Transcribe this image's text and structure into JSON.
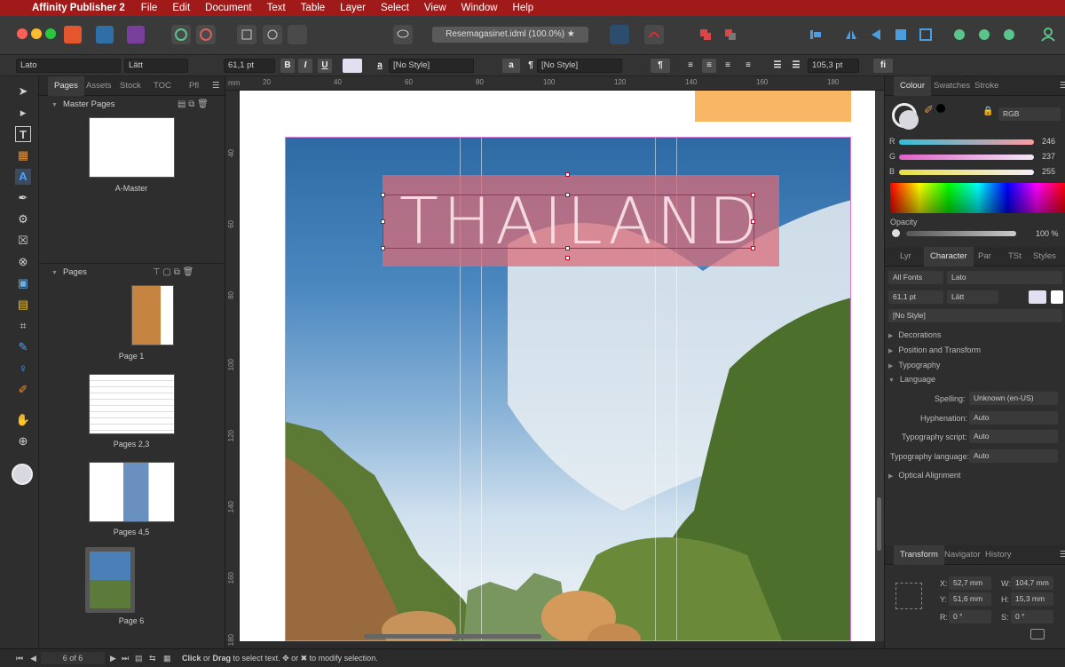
{
  "menubar": {
    "app_name": "Affinity Publisher 2",
    "items": [
      "File",
      "Edit",
      "Document",
      "Text",
      "Table",
      "Layer",
      "Select",
      "View",
      "Window",
      "Help"
    ]
  },
  "toolbar": {
    "document_title": "Resemagasinet.idml (100.0%)"
  },
  "context": {
    "font": "Lato",
    "weight": "Lätt",
    "size": "61,1 pt",
    "bold": "B",
    "italic": "I",
    "underline": "U",
    "char_style": "[No Style]",
    "para_style": "[No Style]",
    "leading": "105,3 pt",
    "fi": "fi",
    "a1": "a",
    "a2": "a",
    "pilcrow": "¶"
  },
  "leftpanel": {
    "tabs": [
      "Pages",
      "Assets",
      "Stock",
      "TOC",
      "Pfl"
    ],
    "master_pages_label": "Master Pages",
    "master_caption": "A-Master",
    "pages_label": "Pages",
    "pages": [
      "Page 1",
      "Pages 2,3",
      "Pages 4,5",
      "Page 6"
    ]
  },
  "ruler": {
    "unit": "mm",
    "top": [
      "20",
      "40",
      "60",
      "80",
      "100",
      "120",
      "140",
      "160",
      "180"
    ],
    "left": [
      "40",
      "60",
      "80",
      "100",
      "120",
      "140",
      "160",
      "180"
    ]
  },
  "canvas": {
    "headline": "THAILAND"
  },
  "status": {
    "page_counter": "6 of 6",
    "hint_click": "Click",
    "hint_or": " or ",
    "hint_drag": "Drag",
    "hint_rest": " to select text. ✥ or ✖ to modify selection."
  },
  "rightpanel": {
    "top_tabs": [
      "Colour",
      "Swatches",
      "Stroke"
    ],
    "color_model": "RGB",
    "r": "246",
    "g": "237",
    "b": "255",
    "opacity_label": "Opacity",
    "opacity_value": "100 %",
    "char_tabs": [
      "Lyr",
      "Character",
      "Par",
      "TSt",
      "Styles"
    ],
    "all_fonts": "All Fonts",
    "font": "Lato",
    "size": "61,1 pt",
    "weight": "Lätt",
    "style": "[No Style]",
    "sections": [
      "Decorations",
      "Position and Transform",
      "Typography",
      "Language"
    ],
    "spelling_label": "Spelling:",
    "spelling_value": "Unknown (en-US)",
    "hyphenation_label": "Hyphenation:",
    "hyphenation_value": "Auto",
    "script_label": "Typography script:",
    "script_value": "Auto",
    "language_label": "Typography language:",
    "language_value": "Auto",
    "optical": "Optical Alignment",
    "transform_tabs": [
      "Transform",
      "Navigator",
      "History"
    ],
    "x_label": "X:",
    "x": "52,7 mm",
    "y_label": "Y:",
    "y": "51,6 mm",
    "w_label": "W:",
    "w": "104,7 mm",
    "h_label": "H:",
    "h": "15,3 mm",
    "r_label": "R:",
    "r_val": "0 °",
    "s_label": "S:",
    "s_val": "0 °"
  },
  "colors": {
    "menubar": "#a01a1a",
    "accent_orange": "#f9b766",
    "selection": "#da6c78"
  }
}
